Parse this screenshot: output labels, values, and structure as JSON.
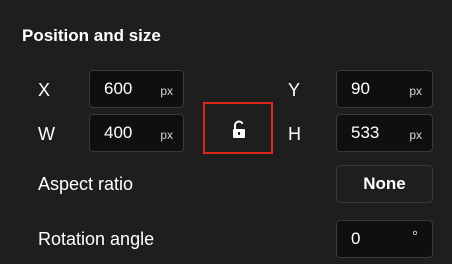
{
  "section_title": "Position and size",
  "x": {
    "label": "X",
    "value": "600",
    "unit": "px"
  },
  "y": {
    "label": "Y",
    "value": "90",
    "unit": "px"
  },
  "w": {
    "label": "W",
    "value": "400",
    "unit": "px"
  },
  "h": {
    "label": "H",
    "value": "533",
    "unit": "px"
  },
  "lock": {
    "icon": "unlock-icon",
    "highlight_color": "#e0251b"
  },
  "aspect_ratio": {
    "label": "Aspect ratio",
    "value": "None"
  },
  "rotation": {
    "label": "Rotation angle",
    "value": "0",
    "unit": "°"
  }
}
